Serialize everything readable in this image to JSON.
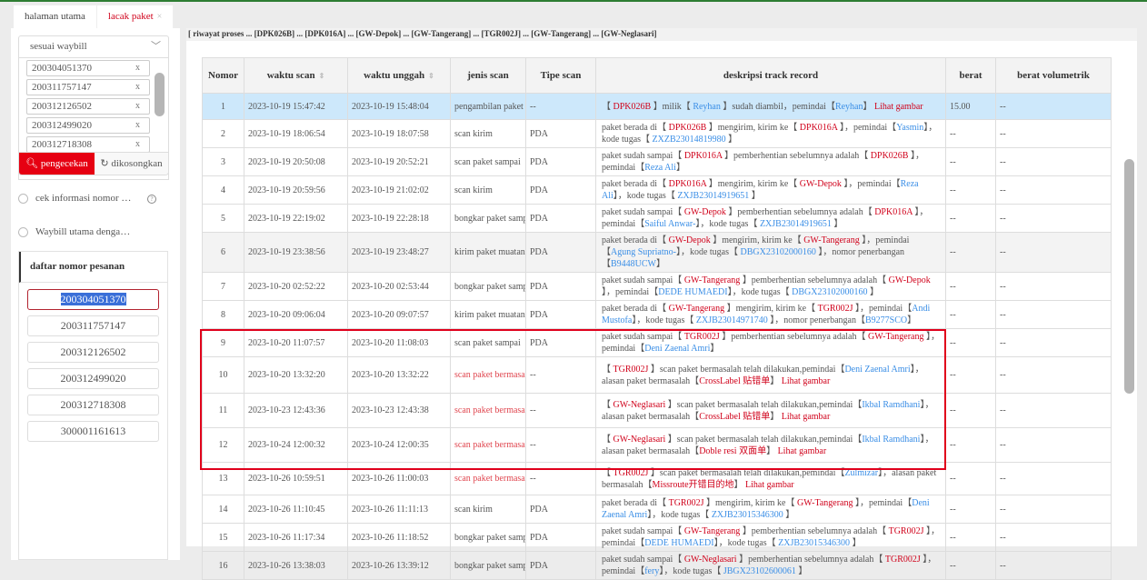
{
  "tabs": [
    {
      "label": "halaman utama"
    },
    {
      "label": "lacak paket",
      "close": "×"
    }
  ],
  "left": {
    "select": "sesuai waybill",
    "waybills": [
      "200304051370",
      "200311757147",
      "200312126502",
      "200312499020",
      "200312718308"
    ],
    "remove": "x",
    "search_btn": "pengecekan",
    "clear_btn": "dikosongkan",
    "radio1": "cek informasi nomor …",
    "radio2": "Waybill utama denga…",
    "help": "?",
    "orders_title": "daftar nomor pesanan",
    "orders": [
      "200304051370",
      "200311757147",
      "200312126502",
      "200312499020",
      "200312718308",
      "300001161613"
    ]
  },
  "strip": "[ riwayat proses ... [DPK026B] ... [DPK016A] ... [GW-Depok] ... [GW-Tangerang] ... [TGR002J] ... [GW-Tangerang] ... [GW-Neglasari]",
  "table": {
    "headers": [
      "Nomor",
      "waktu scan",
      "waktu unggah",
      "jenis scan",
      "Tipe scan",
      "deskripsi track record",
      "berat",
      "berat volumetrik"
    ],
    "rows": [
      {
        "no": "1",
        "scan": "2023-10-19 15:47:42",
        "up": "2023-10-19 15:48:04",
        "jenis": "pengambilan paket",
        "tipe": "--",
        "berat": "15.00",
        "vol": "--",
        "desc": [
          [
            "t",
            "【 "
          ],
          [
            "r",
            "DPK026B"
          ],
          [
            "t",
            " 】milik【 "
          ],
          [
            "b",
            "Reyhan"
          ],
          [
            "t",
            " 】sudah diambil，pemindai【"
          ],
          [
            "b",
            "Reyhan"
          ],
          [
            "t",
            "】 "
          ],
          [
            "r",
            "Lihat gambar"
          ]
        ]
      },
      {
        "no": "2",
        "scan": "2023-10-19 18:06:54",
        "up": "2023-10-19 18:07:58",
        "jenis": "scan kirim",
        "tipe": "PDA",
        "berat": "--",
        "vol": "--",
        "desc": [
          [
            "t",
            "paket berada di【 "
          ],
          [
            "r",
            "DPK026B"
          ],
          [
            "t",
            " 】mengirim, kirim ke【 "
          ],
          [
            "r",
            "DPK016A"
          ],
          [
            "t",
            " 】，pemindai【"
          ],
          [
            "b",
            "Yasmin"
          ],
          [
            "t",
            "】，kode tugas【 "
          ],
          [
            "b",
            "ZXZB23014819980"
          ],
          [
            "t",
            " 】"
          ]
        ]
      },
      {
        "no": "3",
        "scan": "2023-10-19 20:50:08",
        "up": "2023-10-19 20:52:21",
        "jenis": "scan paket sampai",
        "tipe": "PDA",
        "berat": "--",
        "vol": "--",
        "desc": [
          [
            "t",
            "paket sudah sampai【 "
          ],
          [
            "r",
            "DPK016A"
          ],
          [
            "t",
            " 】pemberhentian sebelumnya adalah【 "
          ],
          [
            "r",
            "DPK026B"
          ],
          [
            "t",
            " 】，pemindai【"
          ],
          [
            "b",
            "Reza Ali"
          ],
          [
            "t",
            "】"
          ]
        ]
      },
      {
        "no": "4",
        "scan": "2023-10-19 20:59:56",
        "up": "2023-10-19 21:02:02",
        "jenis": "scan kirim",
        "tipe": "PDA",
        "berat": "--",
        "vol": "--",
        "desc": [
          [
            "t",
            "paket berada di【 "
          ],
          [
            "r",
            "DPK016A"
          ],
          [
            "t",
            " 】mengirim, kirim ke【 "
          ],
          [
            "r",
            "GW-Depok"
          ],
          [
            "t",
            " 】，pemindai【"
          ],
          [
            "b",
            "Reza Ali"
          ],
          [
            "t",
            "】，kode tugas【 "
          ],
          [
            "b",
            "ZXJB23014919651"
          ],
          [
            "t",
            " 】"
          ]
        ]
      },
      {
        "no": "5",
        "scan": "2023-10-19 22:19:02",
        "up": "2023-10-19 22:28:18",
        "jenis": "bongkar paket sampai",
        "tipe": "PDA",
        "berat": "--",
        "vol": "--",
        "desc": [
          [
            "t",
            "paket sudah sampai【 "
          ],
          [
            "r",
            "GW-Depok"
          ],
          [
            "t",
            " 】pemberhentian sebelumnya adalah【 "
          ],
          [
            "r",
            "DPK016A"
          ],
          [
            "t",
            " 】，pemindai【"
          ],
          [
            "b",
            "Saiful Anwar-"
          ],
          [
            "t",
            "】，kode tugas【 "
          ],
          [
            "b",
            "ZXJB23014919651"
          ],
          [
            "t",
            " 】"
          ]
        ]
      },
      {
        "no": "6",
        "scan": "2023-10-19 23:38:56",
        "up": "2023-10-19 23:48:27",
        "jenis": "kirim paket muatan",
        "tipe": "PDA",
        "berat": "--",
        "vol": "--",
        "desc": [
          [
            "t",
            "paket berada di【 "
          ],
          [
            "r",
            "GW-Depok"
          ],
          [
            "t",
            " 】mengirim, kirim ke【 "
          ],
          [
            "r",
            "GW-Tangerang"
          ],
          [
            "t",
            " 】，pemindai【"
          ],
          [
            "b",
            "Agung Supriatno-"
          ],
          [
            "t",
            "】，kode tugas【 "
          ],
          [
            "b",
            "DBGX23102000160"
          ],
          [
            "t",
            " 】，nomor penerbangan【"
          ],
          [
            "b",
            "B9448UCW"
          ],
          [
            "t",
            "】"
          ]
        ]
      },
      {
        "no": "7",
        "scan": "2023-10-20 02:52:22",
        "up": "2023-10-20 02:53:44",
        "jenis": "bongkar paket sampai",
        "tipe": "PDA",
        "berat": "--",
        "vol": "--",
        "desc": [
          [
            "t",
            "paket sudah sampai【 "
          ],
          [
            "r",
            "GW-Tangerang"
          ],
          [
            "t",
            " 】pemberhentian sebelumnya adalah【 "
          ],
          [
            "r",
            "GW-Depok"
          ],
          [
            "t",
            " 】，pemindai【"
          ],
          [
            "b",
            "DEDE HUMAEDI"
          ],
          [
            "t",
            "】，kode tugas【 "
          ],
          [
            "b",
            "DBGX23102000160"
          ],
          [
            "t",
            " 】"
          ]
        ]
      },
      {
        "no": "8",
        "scan": "2023-10-20 09:06:04",
        "up": "2023-10-20 09:07:57",
        "jenis": "kirim paket muatan",
        "tipe": "PDA",
        "berat": "--",
        "vol": "--",
        "desc": [
          [
            "t",
            "paket berada di【 "
          ],
          [
            "r",
            "GW-Tangerang"
          ],
          [
            "t",
            " 】mengirim, kirim ke【 "
          ],
          [
            "r",
            "TGR002J"
          ],
          [
            "t",
            " 】，pemindai【"
          ],
          [
            "b",
            "Andi Mustofa"
          ],
          [
            "t",
            "】，kode tugas【 "
          ],
          [
            "b",
            "ZXJB23014971740"
          ],
          [
            "t",
            " 】，nomor penerbangan【"
          ],
          [
            "b",
            "B9277SCO"
          ],
          [
            "t",
            "】"
          ]
        ]
      },
      {
        "no": "9",
        "scan": "2023-10-20 11:07:57",
        "up": "2023-10-20 11:08:03",
        "jenis": "scan paket sampai",
        "tipe": "PDA",
        "berat": "--",
        "vol": "--",
        "desc": [
          [
            "t",
            "paket sudah sampai【 "
          ],
          [
            "r",
            "TGR002J"
          ],
          [
            "t",
            " 】pemberhentian sebelumnya adalah【 "
          ],
          [
            "r",
            "GW-Tangerang"
          ],
          [
            "t",
            " 】，pemindai【"
          ],
          [
            "b",
            "Deni Zaenal Amri"
          ],
          [
            "t",
            "】"
          ]
        ]
      },
      {
        "no": "10",
        "scan": "2023-10-20 13:32:20",
        "up": "2023-10-20 13:32:22",
        "jenis": "scan paket bermasalah",
        "tipe": "--",
        "berat": "--",
        "vol": "--",
        "problem": true,
        "desc": [
          [
            "t",
            "【 "
          ],
          [
            "r",
            "TGR002J"
          ],
          [
            "t",
            " 】scan paket bermasalah telah dilakukan,pemindai【"
          ],
          [
            "b",
            "Deni Zaenal Amri"
          ],
          [
            "t",
            "】，alasan paket bermasalah【"
          ],
          [
            "r",
            "CrossLabel 贴错单"
          ],
          [
            "t",
            "】 "
          ],
          [
            "r",
            "Lihat gambar"
          ]
        ]
      },
      {
        "no": "11",
        "scan": "2023-10-23 12:43:36",
        "up": "2023-10-23 12:43:38",
        "jenis": "scan paket bermasalah",
        "tipe": "--",
        "berat": "--",
        "vol": "--",
        "problem": true,
        "desc": [
          [
            "t",
            "【 "
          ],
          [
            "r",
            "GW-Neglasari"
          ],
          [
            "t",
            " 】scan paket bermasalah telah dilakukan,pemindai【"
          ],
          [
            "b",
            "Ikbal Ramdhani"
          ],
          [
            "t",
            "】，alasan paket bermasalah【"
          ],
          [
            "r",
            "CrossLabel 贴错单"
          ],
          [
            "t",
            "】 "
          ],
          [
            "r",
            "Lihat gambar"
          ]
        ]
      },
      {
        "no": "12",
        "scan": "2023-10-24 12:00:32",
        "up": "2023-10-24 12:00:35",
        "jenis": "scan paket bermasalah",
        "tipe": "--",
        "berat": "--",
        "vol": "--",
        "problem": true,
        "desc": [
          [
            "t",
            "【 "
          ],
          [
            "r",
            "GW-Neglasari"
          ],
          [
            "t",
            " 】scan paket bermasalah telah dilakukan,pemindai【"
          ],
          [
            "b",
            "Ikbal Ramdhani"
          ],
          [
            "t",
            "】，alasan paket bermasalah【"
          ],
          [
            "r",
            "Doble resi 双面单"
          ],
          [
            "t",
            "】 "
          ],
          [
            "r",
            "Lihat gambar"
          ]
        ]
      },
      {
        "no": "13",
        "scan": "2023-10-26 10:59:51",
        "up": "2023-10-26 11:00:03",
        "jenis": "scan paket bermasalah",
        "tipe": "--",
        "berat": "--",
        "vol": "--",
        "problem": true,
        "desc": [
          [
            "t",
            "【 "
          ],
          [
            "r",
            "TGR002J"
          ],
          [
            "t",
            " 】scan paket bermasalah telah dilakukan,pemindai【"
          ],
          [
            "b",
            "Zulmizar"
          ],
          [
            "t",
            "】，alasan paket bermasalah【"
          ],
          [
            "r",
            "Missroute开错目的地"
          ],
          [
            "t",
            "】 "
          ],
          [
            "r",
            "Lihat gambar"
          ]
        ]
      },
      {
        "no": "14",
        "scan": "2023-10-26 11:10:45",
        "up": "2023-10-26 11:11:13",
        "jenis": "scan kirim",
        "tipe": "PDA",
        "berat": "--",
        "vol": "--",
        "desc": [
          [
            "t",
            "paket berada di【 "
          ],
          [
            "r",
            "TGR002J"
          ],
          [
            "t",
            " 】mengirim, kirim ke【 "
          ],
          [
            "r",
            "GW-Tangerang"
          ],
          [
            "t",
            " 】，pemindai【"
          ],
          [
            "b",
            "Deni Zaenal Amri"
          ],
          [
            "t",
            "】，kode tugas【 "
          ],
          [
            "b",
            "ZXJB23015346300"
          ],
          [
            "t",
            " 】"
          ]
        ]
      },
      {
        "no": "15",
        "scan": "2023-10-26 11:17:34",
        "up": "2023-10-26 11:18:52",
        "jenis": "bongkar paket sampai",
        "tipe": "PDA",
        "berat": "--",
        "vol": "--",
        "desc": [
          [
            "t",
            "paket sudah sampai【 "
          ],
          [
            "r",
            "GW-Tangerang"
          ],
          [
            "t",
            " 】pemberhentian sebelumnya adalah【 "
          ],
          [
            "r",
            "TGR002J"
          ],
          [
            "t",
            " 】，pemindai【"
          ],
          [
            "b",
            "DEDE HUMAEDI"
          ],
          [
            "t",
            "】，kode tugas【 "
          ],
          [
            "b",
            "ZXJB23015346300"
          ],
          [
            "t",
            " 】"
          ]
        ]
      },
      {
        "no": "16",
        "scan": "2023-10-26 13:38:03",
        "up": "2023-10-26 13:39:12",
        "jenis": "bongkar paket sampai",
        "tipe": "PDA",
        "berat": "--",
        "vol": "--",
        "desc": [
          [
            "t",
            "paket sudah sampai【 "
          ],
          [
            "r",
            "GW-Neglasari"
          ],
          [
            "t",
            " 】pemberhentian sebelumnya adalah【 "
          ],
          [
            "r",
            "TGR002J"
          ],
          [
            "t",
            " 】，pemindai【"
          ],
          [
            "b",
            "fery"
          ],
          [
            "t",
            "】，kode tugas【 "
          ],
          [
            "b",
            "JBGX23102600061"
          ],
          [
            "t",
            " 】"
          ]
        ]
      }
    ]
  },
  "colors": {
    "accent": "#e60012",
    "link": "#3a8ee6",
    "highlight_row": "#cde8fb",
    "problem_box": "#e0001b"
  }
}
